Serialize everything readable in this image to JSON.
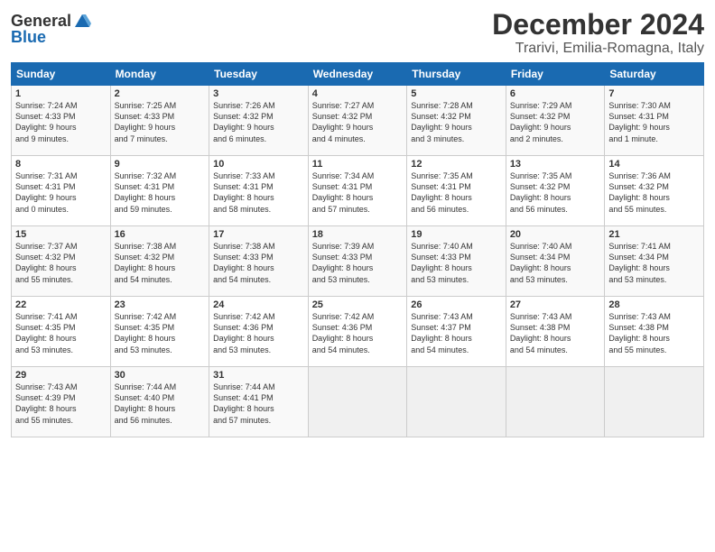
{
  "logo": {
    "general": "General",
    "blue": "Blue"
  },
  "header": {
    "month": "December 2024",
    "location": "Trarivi, Emilia-Romagna, Italy"
  },
  "weekdays": [
    "Sunday",
    "Monday",
    "Tuesday",
    "Wednesday",
    "Thursday",
    "Friday",
    "Saturday"
  ],
  "weeks": [
    [
      {
        "day": "1",
        "text": "Sunrise: 7:24 AM\nSunset: 4:33 PM\nDaylight: 9 hours\nand 9 minutes."
      },
      {
        "day": "2",
        "text": "Sunrise: 7:25 AM\nSunset: 4:33 PM\nDaylight: 9 hours\nand 7 minutes."
      },
      {
        "day": "3",
        "text": "Sunrise: 7:26 AM\nSunset: 4:32 PM\nDaylight: 9 hours\nand 6 minutes."
      },
      {
        "day": "4",
        "text": "Sunrise: 7:27 AM\nSunset: 4:32 PM\nDaylight: 9 hours\nand 4 minutes."
      },
      {
        "day": "5",
        "text": "Sunrise: 7:28 AM\nSunset: 4:32 PM\nDaylight: 9 hours\nand 3 minutes."
      },
      {
        "day": "6",
        "text": "Sunrise: 7:29 AM\nSunset: 4:32 PM\nDaylight: 9 hours\nand 2 minutes."
      },
      {
        "day": "7",
        "text": "Sunrise: 7:30 AM\nSunset: 4:31 PM\nDaylight: 9 hours\nand 1 minute."
      }
    ],
    [
      {
        "day": "8",
        "text": "Sunrise: 7:31 AM\nSunset: 4:31 PM\nDaylight: 9 hours\nand 0 minutes."
      },
      {
        "day": "9",
        "text": "Sunrise: 7:32 AM\nSunset: 4:31 PM\nDaylight: 8 hours\nand 59 minutes."
      },
      {
        "day": "10",
        "text": "Sunrise: 7:33 AM\nSunset: 4:31 PM\nDaylight: 8 hours\nand 58 minutes."
      },
      {
        "day": "11",
        "text": "Sunrise: 7:34 AM\nSunset: 4:31 PM\nDaylight: 8 hours\nand 57 minutes."
      },
      {
        "day": "12",
        "text": "Sunrise: 7:35 AM\nSunset: 4:31 PM\nDaylight: 8 hours\nand 56 minutes."
      },
      {
        "day": "13",
        "text": "Sunrise: 7:35 AM\nSunset: 4:32 PM\nDaylight: 8 hours\nand 56 minutes."
      },
      {
        "day": "14",
        "text": "Sunrise: 7:36 AM\nSunset: 4:32 PM\nDaylight: 8 hours\nand 55 minutes."
      }
    ],
    [
      {
        "day": "15",
        "text": "Sunrise: 7:37 AM\nSunset: 4:32 PM\nDaylight: 8 hours\nand 55 minutes."
      },
      {
        "day": "16",
        "text": "Sunrise: 7:38 AM\nSunset: 4:32 PM\nDaylight: 8 hours\nand 54 minutes."
      },
      {
        "day": "17",
        "text": "Sunrise: 7:38 AM\nSunset: 4:33 PM\nDaylight: 8 hours\nand 54 minutes."
      },
      {
        "day": "18",
        "text": "Sunrise: 7:39 AM\nSunset: 4:33 PM\nDaylight: 8 hours\nand 53 minutes."
      },
      {
        "day": "19",
        "text": "Sunrise: 7:40 AM\nSunset: 4:33 PM\nDaylight: 8 hours\nand 53 minutes."
      },
      {
        "day": "20",
        "text": "Sunrise: 7:40 AM\nSunset: 4:34 PM\nDaylight: 8 hours\nand 53 minutes."
      },
      {
        "day": "21",
        "text": "Sunrise: 7:41 AM\nSunset: 4:34 PM\nDaylight: 8 hours\nand 53 minutes."
      }
    ],
    [
      {
        "day": "22",
        "text": "Sunrise: 7:41 AM\nSunset: 4:35 PM\nDaylight: 8 hours\nand 53 minutes."
      },
      {
        "day": "23",
        "text": "Sunrise: 7:42 AM\nSunset: 4:35 PM\nDaylight: 8 hours\nand 53 minutes."
      },
      {
        "day": "24",
        "text": "Sunrise: 7:42 AM\nSunset: 4:36 PM\nDaylight: 8 hours\nand 53 minutes."
      },
      {
        "day": "25",
        "text": "Sunrise: 7:42 AM\nSunset: 4:36 PM\nDaylight: 8 hours\nand 54 minutes."
      },
      {
        "day": "26",
        "text": "Sunrise: 7:43 AM\nSunset: 4:37 PM\nDaylight: 8 hours\nand 54 minutes."
      },
      {
        "day": "27",
        "text": "Sunrise: 7:43 AM\nSunset: 4:38 PM\nDaylight: 8 hours\nand 54 minutes."
      },
      {
        "day": "28",
        "text": "Sunrise: 7:43 AM\nSunset: 4:38 PM\nDaylight: 8 hours\nand 55 minutes."
      }
    ],
    [
      {
        "day": "29",
        "text": "Sunrise: 7:43 AM\nSunset: 4:39 PM\nDaylight: 8 hours\nand 55 minutes."
      },
      {
        "day": "30",
        "text": "Sunrise: 7:44 AM\nSunset: 4:40 PM\nDaylight: 8 hours\nand 56 minutes."
      },
      {
        "day": "31",
        "text": "Sunrise: 7:44 AM\nSunset: 4:41 PM\nDaylight: 8 hours\nand 57 minutes."
      },
      {
        "day": "",
        "text": ""
      },
      {
        "day": "",
        "text": ""
      },
      {
        "day": "",
        "text": ""
      },
      {
        "day": "",
        "text": ""
      }
    ]
  ]
}
